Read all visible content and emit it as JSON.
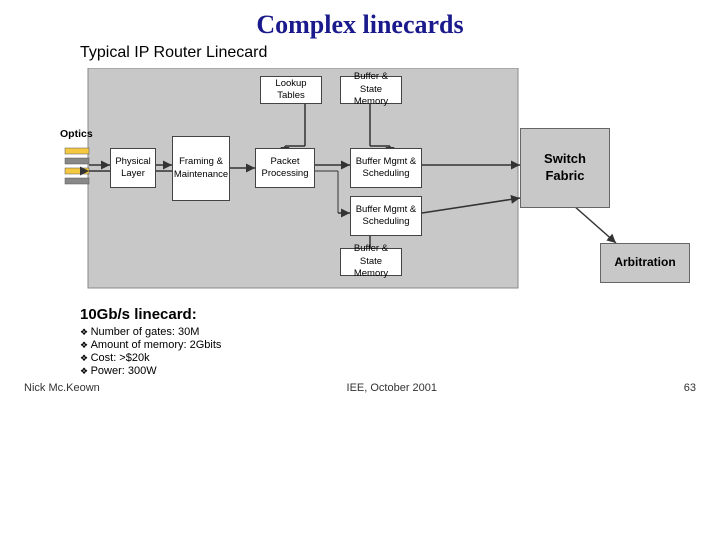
{
  "title": "Complex linecards",
  "subtitle": "Typical IP Router Linecard",
  "diagram": {
    "optics_label": "Optics",
    "physical_layer": "Physical\nLayer",
    "framing_maintenance": "Framing\n&\nMaintenance",
    "lookup_tables": "Lookup\nTables",
    "buffer_state_memory_top": "Buffer\n& State\nMemory",
    "packet_processing": "Packet\nProcessing",
    "buffer_mgmt_scheduling_top": "Buffer Mgmt\n&\nScheduling",
    "buffer_mgmt_scheduling_bot": "Buffer Mgmt\n&\nScheduling",
    "buffer_state_memory_bot": "Buffer\n& State\nMemory",
    "switch_fabric": "Switch\nFabric",
    "arbitration": "Arbitration"
  },
  "info": {
    "title": "10Gb/s linecard:",
    "items": [
      "Number of gates: 30M",
      "Amount of memory: 2Gbits",
      "Cost: >$20k",
      "Power: 300W"
    ]
  },
  "footer": {
    "left": "Nick Mc.Keown",
    "center": "IEE, October 2001",
    "right": "63"
  }
}
